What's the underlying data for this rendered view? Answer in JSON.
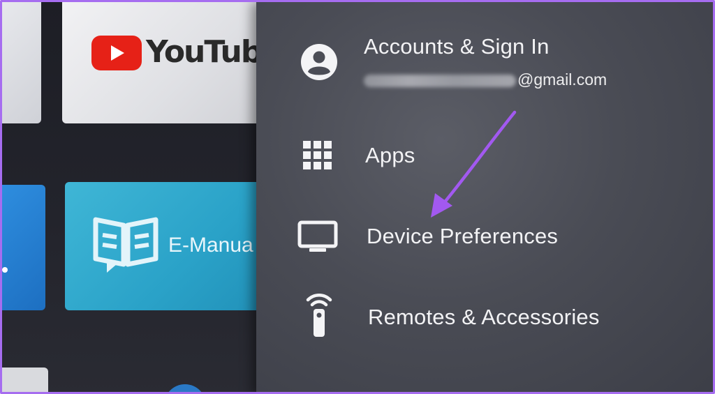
{
  "home": {
    "tiles": {
      "youtube_label": "YouTube",
      "emanual_label": "E-Manua"
    }
  },
  "settings": {
    "items": [
      {
        "label": "Accounts & Sign In",
        "sublabel_suffix": "@gmail.com",
        "icon": "account-circle-icon"
      },
      {
        "label": "Apps",
        "icon": "apps-grid-icon"
      },
      {
        "label": "Device Preferences",
        "icon": "tv-monitor-icon"
      },
      {
        "label": "Remotes & Accessories",
        "icon": "remote-icon"
      }
    ]
  },
  "annotation": {
    "arrow_color": "#a259f0"
  },
  "colors": {
    "frame_border": "#a66df0",
    "panel_bg": "#4a4c55",
    "youtube_red": "#e62117",
    "emanual_tile": "#2aa2c8"
  }
}
